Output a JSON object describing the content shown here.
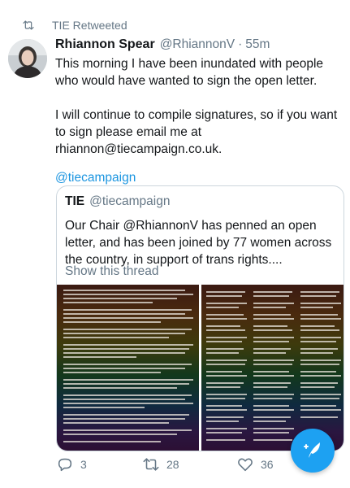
{
  "retweet_context": {
    "label": "TIE Retweeted",
    "icon": "retweet-icon"
  },
  "tweet": {
    "author_name": "Rhiannon Spear",
    "author_handle": "@RhiannonV",
    "separator": "·",
    "timestamp": "55m",
    "text": "This morning I have been inundated with people who would have wanted to sign the open letter.\n\nI will continue to compile signatures, so if you want to sign please email me at rhiannon@tiecampaign.co.uk.",
    "link": "@tiecampaign"
  },
  "quoted_tweet": {
    "author_name": "TIE",
    "author_handle": "@tiecampaign",
    "text": "Our Chair @RhiannonV has penned an open letter, and has been joined by 77 women across the country, in support of trans rights....",
    "show_thread_label": "Show this thread"
  },
  "actions": {
    "reply_count": "3",
    "retweet_count": "28",
    "like_count": "36"
  },
  "compose_button": {
    "icon": "compose-feather-icon"
  },
  "colors": {
    "accent": "#1da1f2",
    "link": "#1b95e0",
    "secondary_text": "#657786",
    "border": "#ccd6dd"
  }
}
